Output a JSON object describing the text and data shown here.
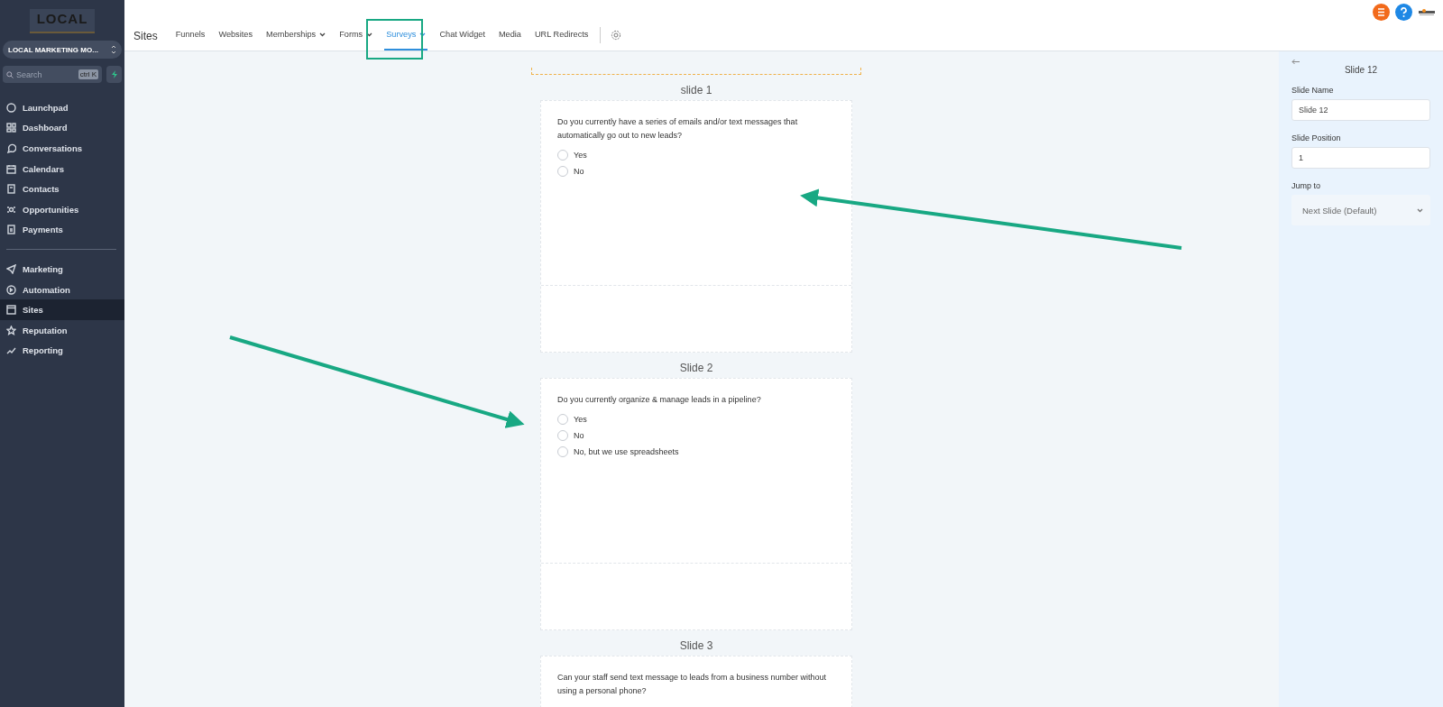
{
  "sidebar": {
    "logo_text": "LOCAL",
    "account": "LOCAL MARKETING MO...",
    "search": {
      "placeholder": "Search",
      "shortcut": "ctrl K"
    },
    "groups": [
      [
        {
          "label": "Launchpad",
          "selected": false
        },
        {
          "label": "Dashboard",
          "selected": false
        },
        {
          "label": "Conversations",
          "selected": false
        },
        {
          "label": "Calendars",
          "selected": false
        },
        {
          "label": "Contacts",
          "selected": false
        },
        {
          "label": "Opportunities",
          "selected": false
        },
        {
          "label": "Payments",
          "selected": false
        }
      ],
      [
        {
          "label": "Marketing",
          "selected": false
        },
        {
          "label": "Automation",
          "selected": false
        },
        {
          "label": "Sites",
          "selected": true
        },
        {
          "label": "Reputation",
          "selected": false
        },
        {
          "label": "Reporting",
          "selected": false
        }
      ]
    ]
  },
  "topbar": {
    "title": "Sites",
    "tabs": [
      {
        "label": "Funnels",
        "dropdown": false,
        "selected": false
      },
      {
        "label": "Websites",
        "dropdown": false,
        "selected": false
      },
      {
        "label": "Memberships",
        "dropdown": true,
        "selected": false
      },
      {
        "label": "Forms",
        "dropdown": true,
        "selected": false
      },
      {
        "label": "Surveys",
        "dropdown": true,
        "selected": true
      },
      {
        "label": "Chat Widget",
        "dropdown": false,
        "selected": false
      },
      {
        "label": "Media",
        "dropdown": false,
        "selected": false
      },
      {
        "label": "URL Redirects",
        "dropdown": false,
        "selected": false
      }
    ]
  },
  "slides": [
    {
      "title": "slide 1",
      "question": "Do you currently have a series of emails and/or text messages that automatically go out to new leads?",
      "options": [
        {
          "label": "Yes",
          "selected": false
        },
        {
          "label": "No",
          "selected": false
        }
      ]
    },
    {
      "title": "Slide 2",
      "question": "Do you currently organize & manage leads in a pipeline?",
      "options": [
        {
          "label": "Yes",
          "selected": false
        },
        {
          "label": "No",
          "selected": false
        },
        {
          "label": "No, but we use spreadsheets",
          "selected": false
        }
      ]
    },
    {
      "title": "Slide 3",
      "question": "Can your staff send text message to leads from a business number without using a personal phone?"
    }
  ],
  "panel": {
    "title": "Slide 12",
    "fields": [
      {
        "label": "Slide Name",
        "value": "Slide 12",
        "kind": "input"
      },
      {
        "label": "Slide Position",
        "value": "1",
        "kind": "input"
      },
      {
        "label": "Jump to",
        "value": "Next Slide (Default)",
        "kind": "select"
      }
    ]
  }
}
